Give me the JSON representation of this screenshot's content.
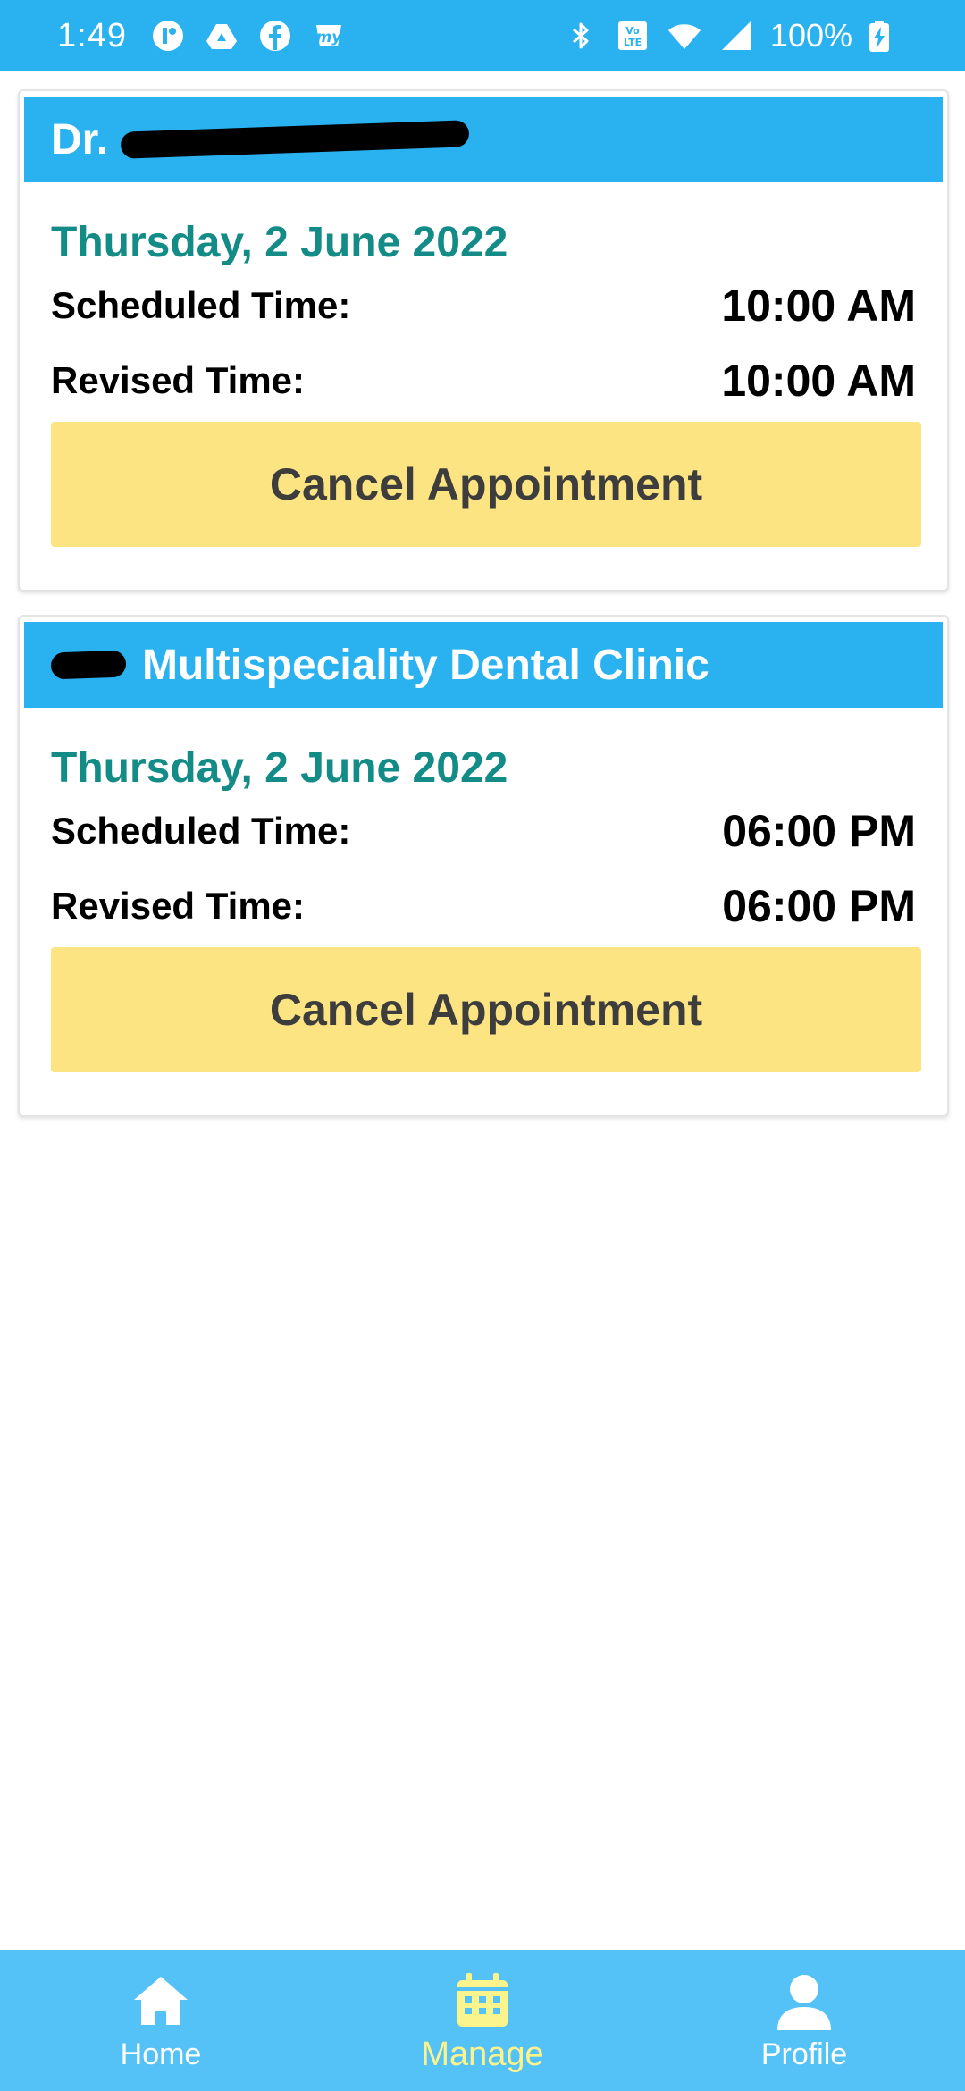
{
  "status_bar": {
    "time": "1:49",
    "battery_percent": "100%",
    "left_icons": [
      "r-app-icon",
      "google-drive-icon",
      "facebook-icon",
      "myntra-icon"
    ],
    "right_icons": [
      "bluetooth-icon",
      "volte-icon",
      "wifi-icon",
      "signal-icon",
      "battery-charging-icon"
    ]
  },
  "appointments": [
    {
      "provider_prefix": "Dr.",
      "provider_name_redacted": true,
      "date": "Thursday, 2 June 2022",
      "scheduled_label": "Scheduled Time:",
      "scheduled_time": "10:00 AM",
      "revised_label": "Revised Time:",
      "revised_time": "10:00 AM",
      "cancel_label": "Cancel Appointment"
    },
    {
      "provider_prefix": "",
      "provider_name": "Multispeciality Dental Clinic",
      "provider_name_redacted_prefix": true,
      "date": "Thursday, 2 June 2022",
      "scheduled_label": "Scheduled Time:",
      "scheduled_time": "06:00 PM",
      "revised_label": "Revised Time:",
      "revised_time": "06:00 PM",
      "cancel_label": "Cancel Appointment"
    }
  ],
  "bottom_nav": {
    "items": [
      {
        "label": "Home",
        "icon": "home-icon"
      },
      {
        "label": "Manage",
        "icon": "calendar-icon",
        "active": true
      },
      {
        "label": "Profile",
        "icon": "person-icon"
      }
    ]
  },
  "colors": {
    "primary": "#29b1f0",
    "nav_bg": "#55c2f7",
    "date_text": "#138b86",
    "cancel_button": "#fde482",
    "active_nav": "#fbf38b"
  }
}
